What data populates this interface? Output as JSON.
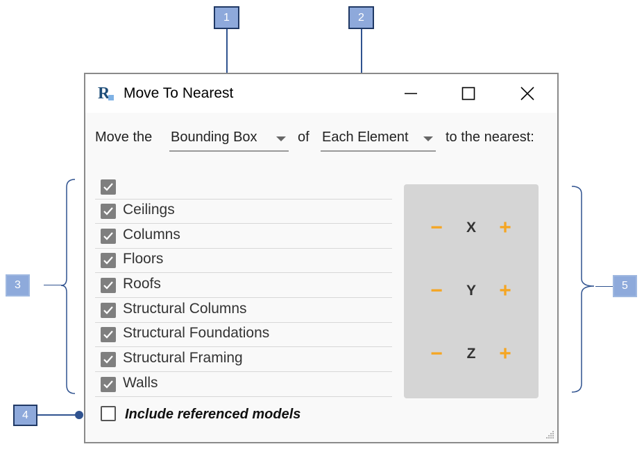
{
  "callouts": [
    "1",
    "2",
    "3",
    "4",
    "5"
  ],
  "dialog": {
    "title": "Move To Nearest",
    "app_icon_letter": "R",
    "controls": {
      "minimize": "minimize-icon",
      "maximize": "maximize-icon",
      "close": "close-icon"
    },
    "sentence": {
      "prefix": "Move the",
      "reference": "Bounding Box",
      "connector": "of",
      "scope": "Each Element",
      "suffix": "to the nearest:"
    },
    "categories": [
      {
        "label": "",
        "checked": true
      },
      {
        "label": "Ceilings",
        "checked": true
      },
      {
        "label": "Columns",
        "checked": true
      },
      {
        "label": "Floors",
        "checked": true
      },
      {
        "label": "Roofs",
        "checked": true
      },
      {
        "label": "Structural Columns",
        "checked": true
      },
      {
        "label": "Structural Foundations",
        "checked": true
      },
      {
        "label": "Structural Framing",
        "checked": true
      },
      {
        "label": "Walls",
        "checked": true
      }
    ],
    "axes": [
      {
        "minus": "−",
        "label": "X",
        "plus": "+"
      },
      {
        "minus": "−",
        "label": "Y",
        "plus": "+"
      },
      {
        "minus": "−",
        "label": "Z",
        "plus": "+"
      }
    ],
    "include_referenced": {
      "label": "Include referenced models",
      "checked": false
    }
  },
  "colors": {
    "callout_fill": "#8ea9db",
    "callout_line": "#2f528f",
    "accent": "#f5a623",
    "checkbox": "#7f7f7f"
  }
}
